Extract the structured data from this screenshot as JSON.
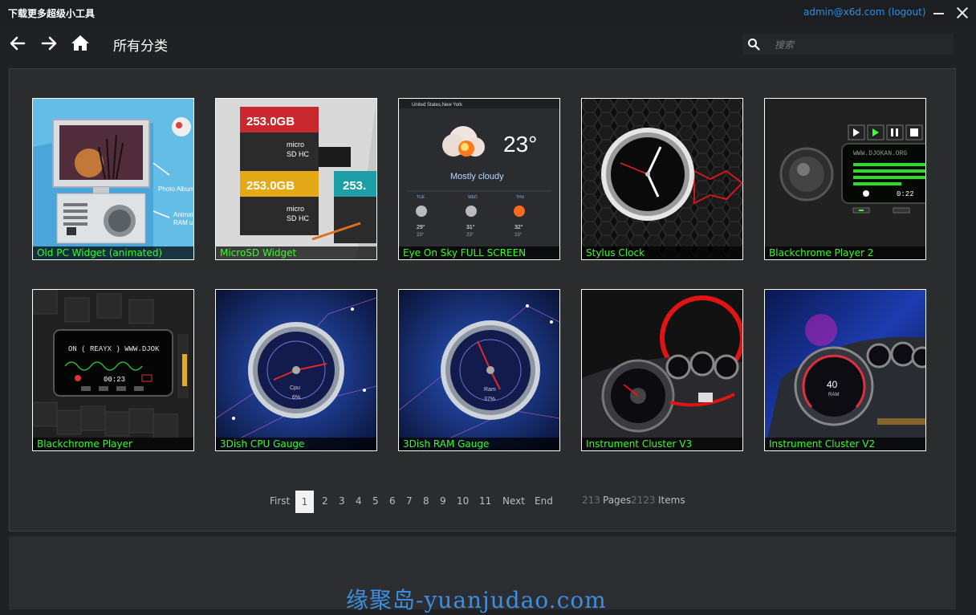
{
  "window": {
    "title": "下载更多超级小工具",
    "user": "admin@x6d.com (logout)"
  },
  "nav": {
    "page_title": "所有分类"
  },
  "search": {
    "placeholder": "搜索",
    "value": ""
  },
  "widgets": [
    {
      "name": "Old PC Widget (animated)"
    },
    {
      "name": "MicroSD Widget"
    },
    {
      "name": "Eye On Sky FULL SCREEN"
    },
    {
      "name": "Stylus Clock"
    },
    {
      "name": "Blackchrome Player 2"
    },
    {
      "name": "Blackchrome Player"
    },
    {
      "name": "3Dish CPU Gauge"
    },
    {
      "name": "3Dish RAM Gauge"
    },
    {
      "name": "Instrument Cluster V3"
    },
    {
      "name": "Instrument Cluster V2"
    }
  ],
  "thumbs": {
    "photo_album": "Photo Album",
    "animated_ram": "Animat",
    "ram_u": "RAM u",
    "sd1_capacity": "253.0GB",
    "sd2_capacity": "253.0GB",
    "sd3_capacity": "253.",
    "weather_city": "United States,New York",
    "weather_temp": "23°",
    "weather_desc": "Mostly cloudy",
    "weather_days": [
      {
        "day": "TUE",
        "hi": "29°",
        "lo": "23°"
      },
      {
        "day": "WED",
        "hi": "31°",
        "lo": "23°"
      },
      {
        "day": "THU",
        "hi": "32°",
        "lo": "23°"
      }
    ],
    "player2_url": "WWW.DJOKAN.ORG",
    "player2_time": "0:22",
    "player1_text": "ON ( REAYX ) WWW.DJOK",
    "player1_time": "00:23",
    "cpu_label": "Cpu",
    "cpu_percent": "6%",
    "ram_label": "Ram",
    "ram_percent": "37%",
    "cluster_v2_value": "40",
    "cluster_v2_unit": "RAM"
  },
  "pagination": {
    "first": "First",
    "current": "1",
    "pages": [
      "2",
      "3",
      "4",
      "5",
      "6",
      "7",
      "8",
      "9",
      "10",
      "11"
    ],
    "next": "Next",
    "end": "End",
    "total_pages": "213",
    "pages_label": "Pages",
    "total_items": "2123",
    "items_label": "Items"
  },
  "watermark": "缘聚岛-yuanjudao.com",
  "colors": {
    "accent_link": "#2d8fe0",
    "label_green": "#33ff22",
    "background": "#1f2124",
    "panel": "#2b2c2e"
  }
}
